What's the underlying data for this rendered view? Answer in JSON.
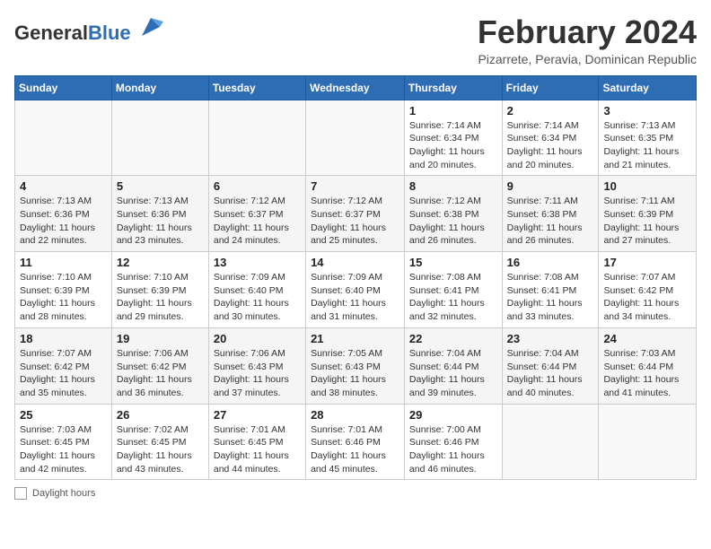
{
  "header": {
    "logo_general": "General",
    "logo_blue": "Blue",
    "month_year": "February 2024",
    "location": "Pizarrete, Peravia, Dominican Republic"
  },
  "days_of_week": [
    "Sunday",
    "Monday",
    "Tuesday",
    "Wednesday",
    "Thursday",
    "Friday",
    "Saturday"
  ],
  "weeks": [
    [
      {
        "day": "",
        "info": ""
      },
      {
        "day": "",
        "info": ""
      },
      {
        "day": "",
        "info": ""
      },
      {
        "day": "",
        "info": ""
      },
      {
        "day": "1",
        "info": "Sunrise: 7:14 AM\nSunset: 6:34 PM\nDaylight: 11 hours and 20 minutes."
      },
      {
        "day": "2",
        "info": "Sunrise: 7:14 AM\nSunset: 6:34 PM\nDaylight: 11 hours and 20 minutes."
      },
      {
        "day": "3",
        "info": "Sunrise: 7:13 AM\nSunset: 6:35 PM\nDaylight: 11 hours and 21 minutes."
      }
    ],
    [
      {
        "day": "4",
        "info": "Sunrise: 7:13 AM\nSunset: 6:36 PM\nDaylight: 11 hours and 22 minutes."
      },
      {
        "day": "5",
        "info": "Sunrise: 7:13 AM\nSunset: 6:36 PM\nDaylight: 11 hours and 23 minutes."
      },
      {
        "day": "6",
        "info": "Sunrise: 7:12 AM\nSunset: 6:37 PM\nDaylight: 11 hours and 24 minutes."
      },
      {
        "day": "7",
        "info": "Sunrise: 7:12 AM\nSunset: 6:37 PM\nDaylight: 11 hours and 25 minutes."
      },
      {
        "day": "8",
        "info": "Sunrise: 7:12 AM\nSunset: 6:38 PM\nDaylight: 11 hours and 26 minutes."
      },
      {
        "day": "9",
        "info": "Sunrise: 7:11 AM\nSunset: 6:38 PM\nDaylight: 11 hours and 26 minutes."
      },
      {
        "day": "10",
        "info": "Sunrise: 7:11 AM\nSunset: 6:39 PM\nDaylight: 11 hours and 27 minutes."
      }
    ],
    [
      {
        "day": "11",
        "info": "Sunrise: 7:10 AM\nSunset: 6:39 PM\nDaylight: 11 hours and 28 minutes."
      },
      {
        "day": "12",
        "info": "Sunrise: 7:10 AM\nSunset: 6:39 PM\nDaylight: 11 hours and 29 minutes."
      },
      {
        "day": "13",
        "info": "Sunrise: 7:09 AM\nSunset: 6:40 PM\nDaylight: 11 hours and 30 minutes."
      },
      {
        "day": "14",
        "info": "Sunrise: 7:09 AM\nSunset: 6:40 PM\nDaylight: 11 hours and 31 minutes."
      },
      {
        "day": "15",
        "info": "Sunrise: 7:08 AM\nSunset: 6:41 PM\nDaylight: 11 hours and 32 minutes."
      },
      {
        "day": "16",
        "info": "Sunrise: 7:08 AM\nSunset: 6:41 PM\nDaylight: 11 hours and 33 minutes."
      },
      {
        "day": "17",
        "info": "Sunrise: 7:07 AM\nSunset: 6:42 PM\nDaylight: 11 hours and 34 minutes."
      }
    ],
    [
      {
        "day": "18",
        "info": "Sunrise: 7:07 AM\nSunset: 6:42 PM\nDaylight: 11 hours and 35 minutes."
      },
      {
        "day": "19",
        "info": "Sunrise: 7:06 AM\nSunset: 6:42 PM\nDaylight: 11 hours and 36 minutes."
      },
      {
        "day": "20",
        "info": "Sunrise: 7:06 AM\nSunset: 6:43 PM\nDaylight: 11 hours and 37 minutes."
      },
      {
        "day": "21",
        "info": "Sunrise: 7:05 AM\nSunset: 6:43 PM\nDaylight: 11 hours and 38 minutes."
      },
      {
        "day": "22",
        "info": "Sunrise: 7:04 AM\nSunset: 6:44 PM\nDaylight: 11 hours and 39 minutes."
      },
      {
        "day": "23",
        "info": "Sunrise: 7:04 AM\nSunset: 6:44 PM\nDaylight: 11 hours and 40 minutes."
      },
      {
        "day": "24",
        "info": "Sunrise: 7:03 AM\nSunset: 6:44 PM\nDaylight: 11 hours and 41 minutes."
      }
    ],
    [
      {
        "day": "25",
        "info": "Sunrise: 7:03 AM\nSunset: 6:45 PM\nDaylight: 11 hours and 42 minutes."
      },
      {
        "day": "26",
        "info": "Sunrise: 7:02 AM\nSunset: 6:45 PM\nDaylight: 11 hours and 43 minutes."
      },
      {
        "day": "27",
        "info": "Sunrise: 7:01 AM\nSunset: 6:45 PM\nDaylight: 11 hours and 44 minutes."
      },
      {
        "day": "28",
        "info": "Sunrise: 7:01 AM\nSunset: 6:46 PM\nDaylight: 11 hours and 45 minutes."
      },
      {
        "day": "29",
        "info": "Sunrise: 7:00 AM\nSunset: 6:46 PM\nDaylight: 11 hours and 46 minutes."
      },
      {
        "day": "",
        "info": ""
      },
      {
        "day": "",
        "info": ""
      }
    ]
  ],
  "footer": {
    "legend_label": "Daylight hours"
  }
}
